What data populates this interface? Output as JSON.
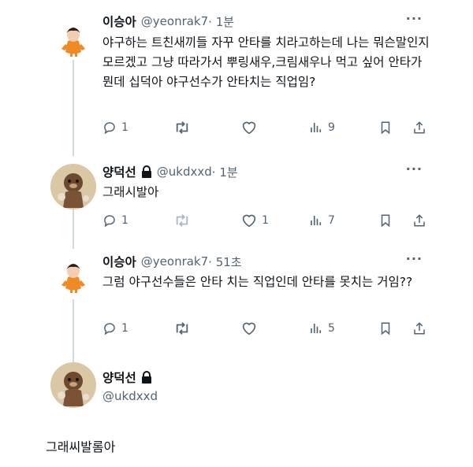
{
  "tweets": [
    {
      "name": "이승아",
      "handle": "@yeonrak7",
      "time": "· 1분",
      "locked": false,
      "text": "야구하는 트친새끼들 자꾸 안타를 치라고하는데 나는 뭐슨말인지 모르겠고 그냥 따라가서 뿌링새우,크림새우나 먹고 싶어 안타가 뭔데 십덕아 야구선수가 안타치는 직업임?",
      "replies": "1",
      "retweets": "",
      "likes": "",
      "views": "9"
    },
    {
      "name": "양덕선",
      "handle": "@ukdxxd",
      "time": "· 1분",
      "locked": true,
      "text": "그래시발아",
      "replies": "1",
      "retweets": "",
      "likes": "1",
      "views": "7"
    },
    {
      "name": "이승아",
      "handle": "@yeonrak7",
      "time": "· 51초",
      "locked": false,
      "text": "그럼 야구선수들은 안타 치는 직업인데 안타를 못치는 거임??",
      "replies": "1",
      "retweets": "",
      "likes": "",
      "views": "5"
    },
    {
      "name": "양덕선",
      "handle": "@ukdxxd",
      "locked": true
    }
  ],
  "standalone_text": "그래씨발롬아",
  "more_glyph": "···",
  "colors": {
    "text": "#0f1419",
    "secondary": "#536471",
    "line": "#cfd9de"
  },
  "icons": [
    "reply-icon",
    "retweet-icon",
    "like-icon",
    "views-icon",
    "bookmark-icon",
    "share-icon",
    "lock-icon",
    "more-icon"
  ]
}
